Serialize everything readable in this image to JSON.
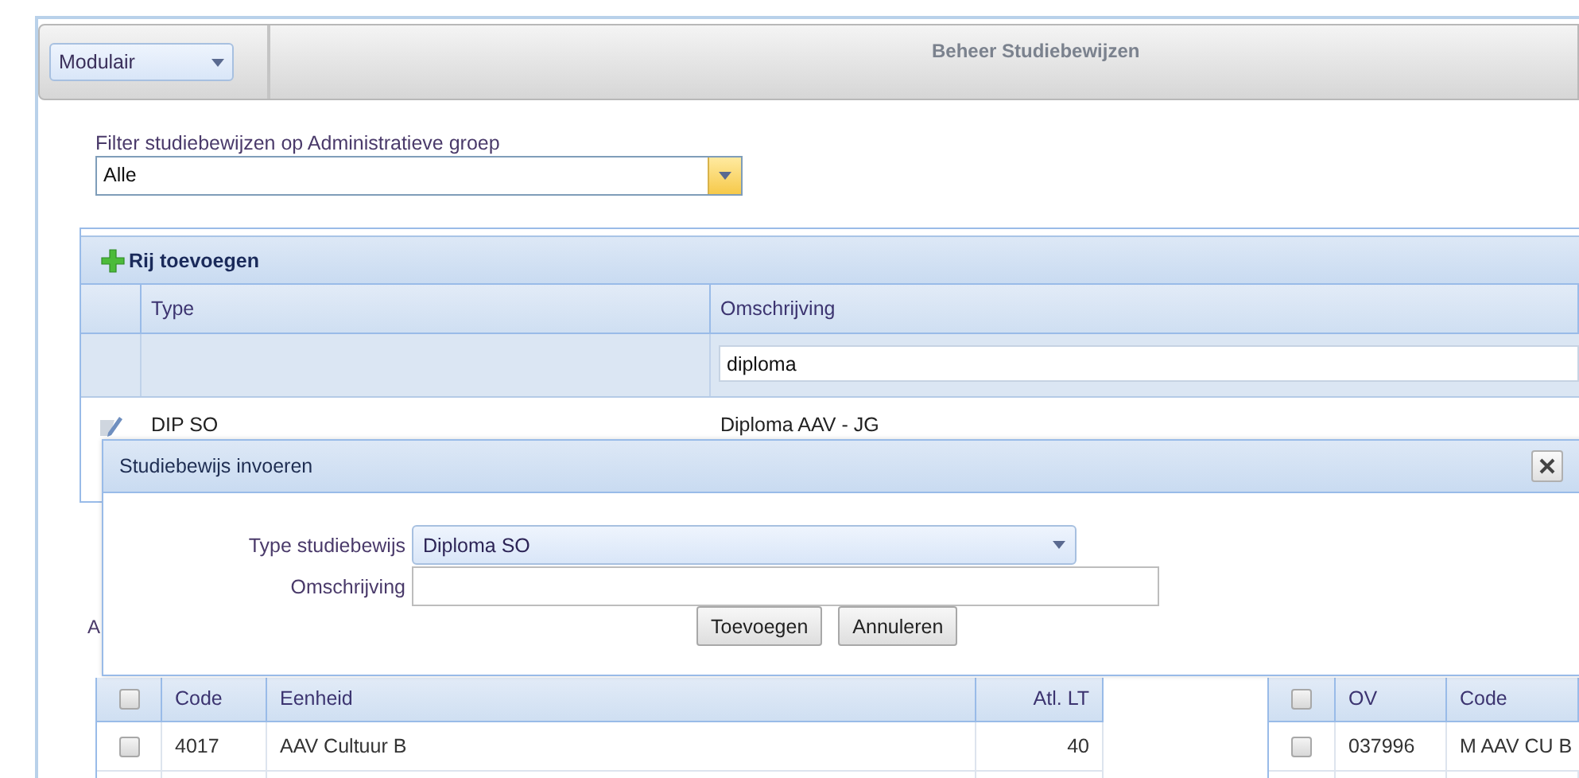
{
  "toolbar": {
    "mode_dropdown": {
      "value": "Modulair"
    },
    "title": "Beheer Studiebewijzen"
  },
  "filter": {
    "label": "Filter studiebewijzen op Administratieve groep",
    "value": "Alle"
  },
  "grid": {
    "add_button": "Rij toevoegen",
    "columns": [
      "Type",
      "Omschrijving"
    ],
    "omschrijving_filter": "diploma",
    "rows": [
      {
        "type": "DIP SO",
        "omschrijving": "Diploma AAV - JG"
      }
    ]
  },
  "label_fragment": "A",
  "dialog": {
    "title": "Studiebewijs invoeren",
    "fields": [
      {
        "label": "Type studiebewijs",
        "kind": "select",
        "value": "Diploma SO"
      },
      {
        "label": "Omschrijving",
        "kind": "text"
      }
    ],
    "buttons": [
      "Toevoegen",
      "Annuleren"
    ]
  },
  "units_table": {
    "columns": [
      "Code",
      "Eenheid",
      "Atl. LT"
    ],
    "header_checked": false,
    "rows": [
      {
        "checked": false,
        "cells": [
          "4017",
          "AAV Cultuur B",
          "40"
        ]
      }
    ]
  },
  "ov_table": {
    "columns": [
      "OV",
      "Code"
    ],
    "header_checked": false,
    "rows": [
      {
        "checked": false,
        "cells": [
          "037996",
          "M AAV CU B"
        ]
      }
    ]
  }
}
